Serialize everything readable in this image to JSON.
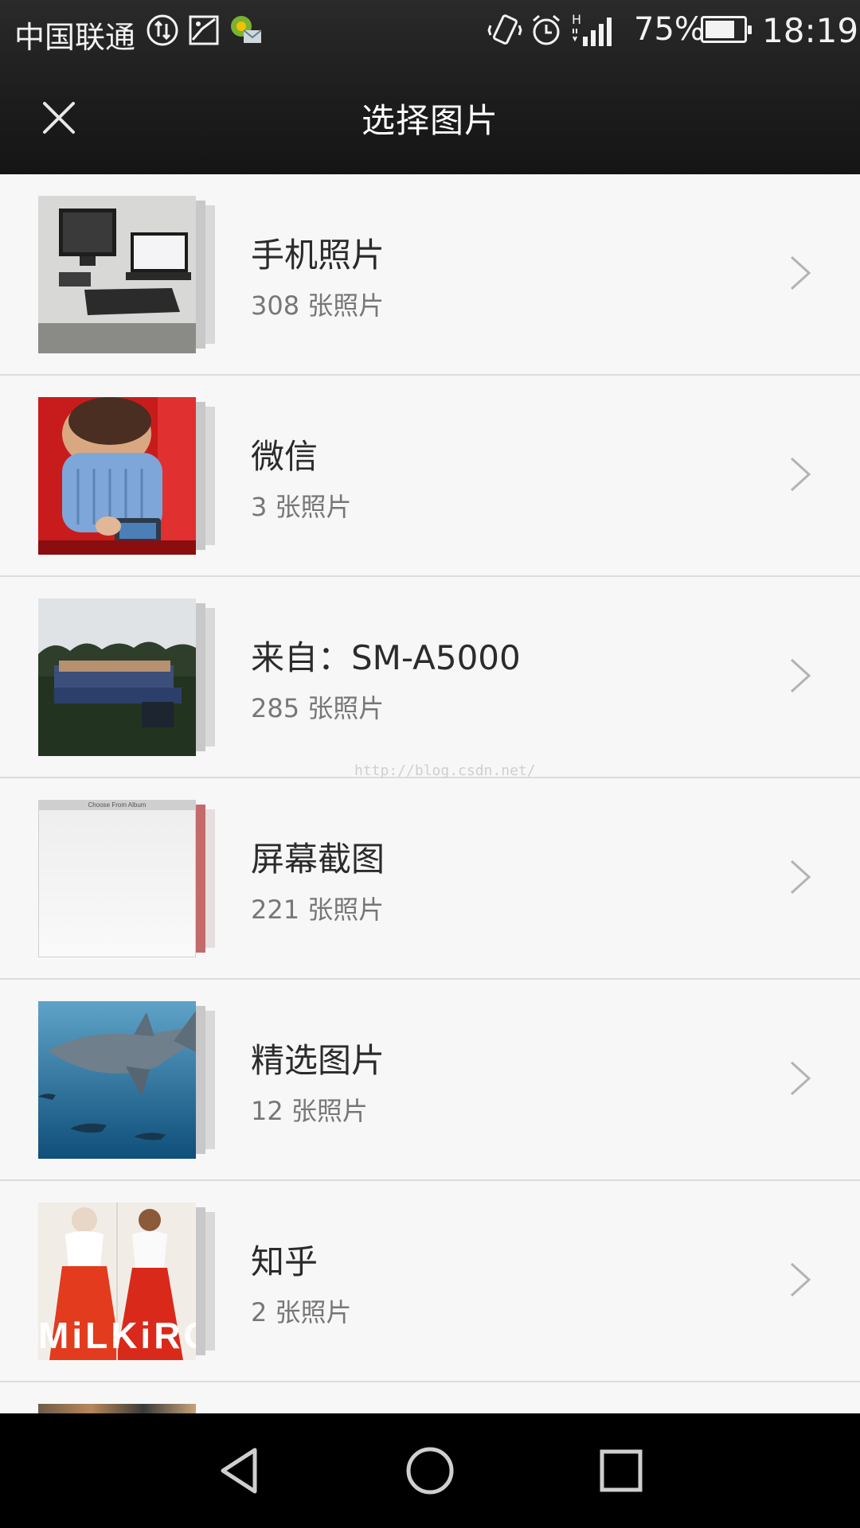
{
  "status_bar": {
    "carrier": "中国联通",
    "battery_percent": "75%",
    "battery_level": 0.75,
    "time": "18:19",
    "network_label": "H",
    "icons": [
      "data-sync-icon",
      "gallery-icon",
      "chat-message-icon",
      "vibrate-icon",
      "alarm-icon",
      "signal-icon",
      "battery-icon"
    ]
  },
  "header": {
    "title": "选择图片",
    "close_icon": "close-icon"
  },
  "albums": [
    {
      "name": "手机照片",
      "count": "308 张照片"
    },
    {
      "name": "微信",
      "count": "3 张照片"
    },
    {
      "name": "来自：SM-A5000",
      "count": "285 张照片"
    },
    {
      "name": "屏幕截图",
      "count": "221 张照片"
    },
    {
      "name": "精选图片",
      "count": "12 张照片"
    },
    {
      "name": "知乎",
      "count": "2 张照片"
    }
  ],
  "thumbnail_texts": {
    "screenshot_header": "Choose From Album",
    "zhihu_overlay": "MiLKiRO"
  },
  "watermark": "http://blog.csdn.net/",
  "nav_bar": {
    "back_icon": "back-icon",
    "home_icon": "home-icon",
    "recents_icon": "recents-icon"
  }
}
